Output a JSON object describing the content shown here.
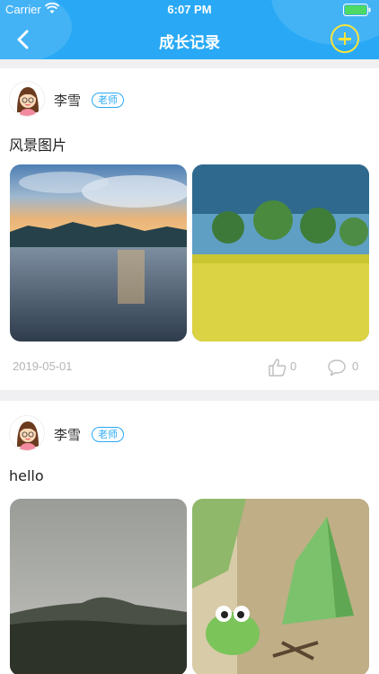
{
  "status_bar": {
    "carrier": "Carrier",
    "time": "6:07 PM"
  },
  "nav": {
    "title": "成长记录",
    "back_icon": "chevron-left-icon",
    "add_icon": "plus-circle-icon"
  },
  "posts": [
    {
      "author": "李雪",
      "role": "老师",
      "text": "风景图片",
      "images": [
        "lake-sunset-photo",
        "rapeseed-field-photo"
      ],
      "date": "2019-05-01",
      "likes": "0",
      "comments": "0"
    },
    {
      "author": "李雪",
      "role": "老师",
      "text": "hello",
      "images": [
        "foggy-hill-photo",
        "cartoon-frog-tent-photo"
      ]
    }
  ],
  "colors": {
    "brand": "#29a9f5",
    "accent": "#f7e43b"
  }
}
